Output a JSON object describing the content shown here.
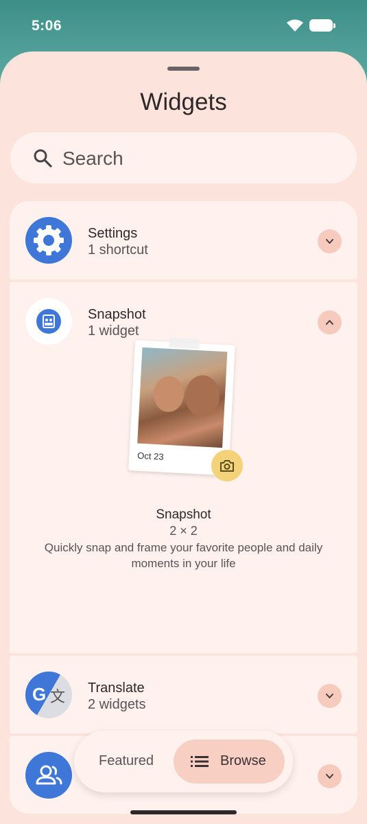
{
  "status_bar": {
    "time": "5:06"
  },
  "sheet": {
    "title": "Widgets"
  },
  "search": {
    "placeholder": "Search"
  },
  "apps": [
    {
      "title": "Settings",
      "subtitle": "1 shortcut",
      "icon": "gear-icon",
      "icon_color": "#3f77d8",
      "expanded": false
    },
    {
      "title": "Snapshot",
      "subtitle": "1 widget",
      "icon": "snapshot-icon",
      "icon_color": "#3f77d8",
      "expanded": true
    },
    {
      "title": "Translate",
      "subtitle": "2 widgets",
      "icon": "translate-icon",
      "icon_color": "#3f77d8",
      "expanded": false
    },
    {
      "title": "",
      "subtitle": "",
      "icon": "contacts-icon",
      "icon_color": "#3f77d8",
      "expanded": false
    }
  ],
  "snapshot_widget": {
    "photo_date": "Oct 23",
    "name": "Snapshot",
    "size": "2 × 2",
    "description": "Quickly snap and frame your favorite people and daily moments in your life"
  },
  "bottom_tabs": {
    "featured": "Featured",
    "browse": "Browse",
    "selected": "browse"
  },
  "colors": {
    "accent": "#3f77d8",
    "sheet": "#fce4dd",
    "chevron_bg": "#f6cabd",
    "browse_bg": "#f8cfc3"
  }
}
